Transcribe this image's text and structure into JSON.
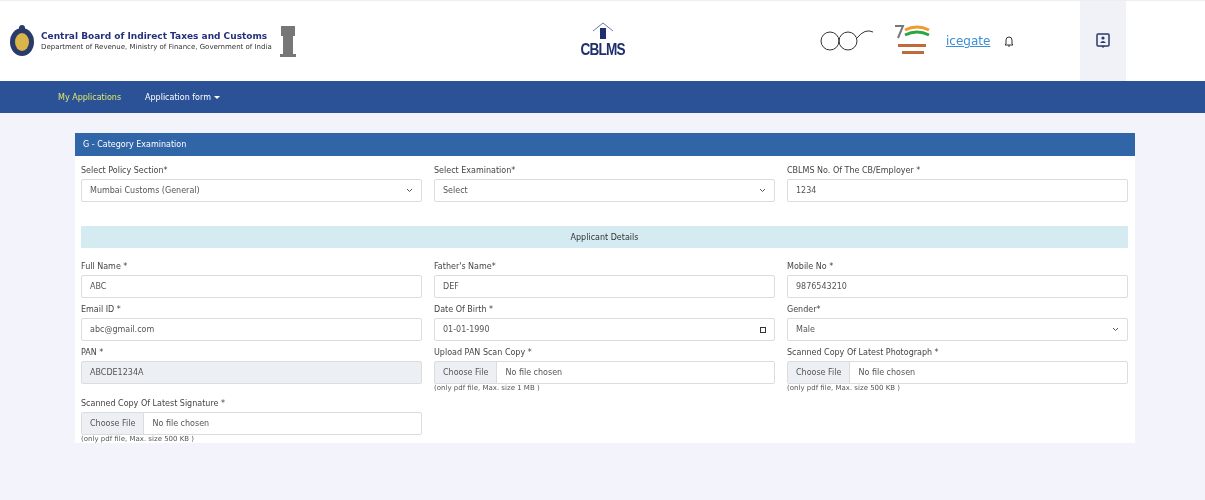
{
  "header": {
    "org_title": "Central Board of Indirect Taxes and Customs",
    "org_subtitle": "Department of Revenue, Ministry of Finance, Government of India",
    "app_logo": "CBLMS",
    "partner_logo": "icegate"
  },
  "nav": [
    {
      "label": "My Applications",
      "selected": true,
      "dropdown": false
    },
    {
      "label": "Application form",
      "selected": false,
      "dropdown": true
    }
  ],
  "card": {
    "title": "G - Category Examination",
    "top_fields": [
      {
        "kind": "select",
        "label": "Select Policy Section*",
        "value": "Mumbai Customs (General)"
      },
      {
        "kind": "select",
        "label": "Select Examination*",
        "value": "Select"
      },
      {
        "kind": "text",
        "label": "CBLMS No. Of The CB/Employer *",
        "value": "1234"
      }
    ],
    "section_title": "Applicant Details",
    "fields": [
      {
        "kind": "text",
        "label": "Full Name *",
        "value": "ABC"
      },
      {
        "kind": "text",
        "label": "Father's Name*",
        "value": "DEF"
      },
      {
        "kind": "text",
        "label": "Mobile No *",
        "value": "9876543210"
      },
      {
        "kind": "text",
        "label": "Email ID *",
        "value": "abc@gmail.com"
      },
      {
        "kind": "date",
        "label": "Date Of Birth *",
        "value": "01-01-1990"
      },
      {
        "kind": "select",
        "label": "Gender*",
        "value": "Male"
      },
      {
        "kind": "readonly",
        "label": "PAN *",
        "value": "ABCDE1234A"
      },
      {
        "kind": "file",
        "label": "Upload PAN Scan Copy *",
        "button": "Choose File",
        "value": "No file chosen",
        "hint": "(only pdf file, Max. size 1 MB )"
      },
      {
        "kind": "file",
        "label": "Scanned Copy Of Latest Photograph *",
        "button": "Choose File",
        "value": "No file chosen",
        "hint": "(only pdf file, Max. size 500 KB )"
      },
      {
        "kind": "file",
        "label": "Scanned Copy Of Latest Signature *",
        "button": "Choose File",
        "value": "No file chosen",
        "hint": "(only pdf file, Max. size 500 KB )"
      }
    ]
  }
}
